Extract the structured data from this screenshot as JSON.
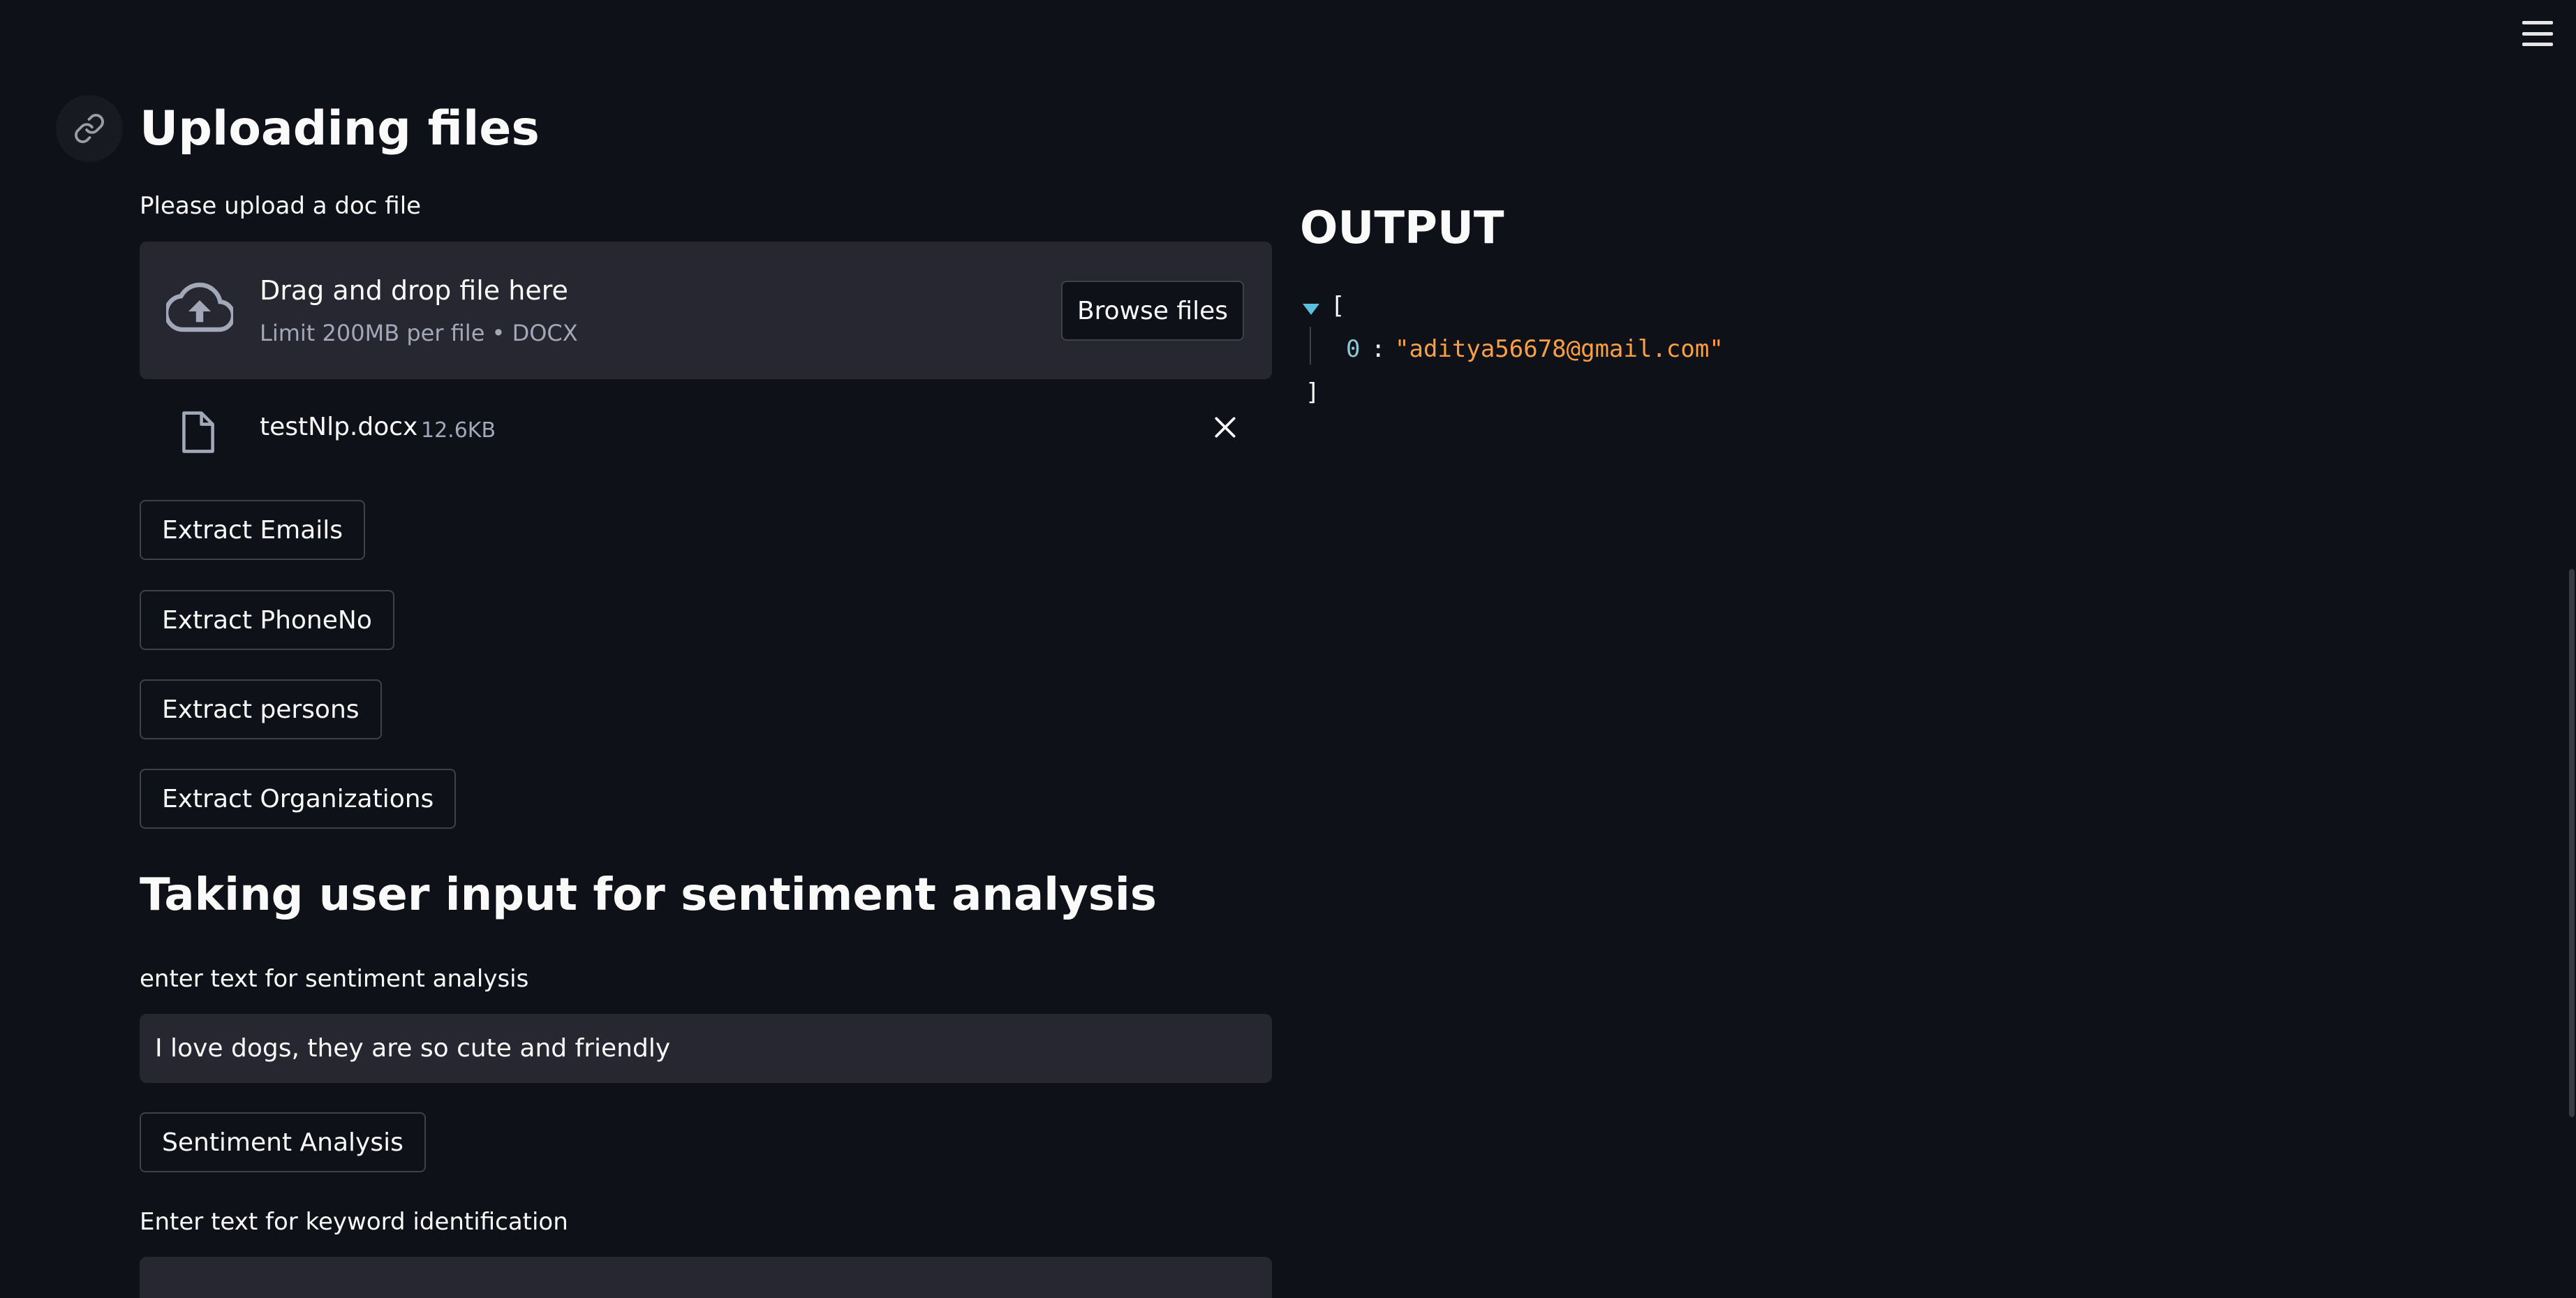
{
  "header": {
    "menu_icon": "hamburger-menu-icon"
  },
  "upload_section": {
    "title": "Uploading files",
    "anchor_icon": "link-icon",
    "uploader_label": "Please upload a doc file",
    "dropzone": {
      "icon": "cloud-upload-icon",
      "title": "Drag and drop file here",
      "subtitle": "Limit 200MB per file • DOCX",
      "browse_label": "Browse files"
    },
    "uploaded_file": {
      "icon": "file-icon",
      "name": "testNlp.docx",
      "size": "12.6KB",
      "remove_icon": "close-icon"
    },
    "buttons": {
      "emails": "Extract Emails",
      "phone": "Extract PhoneNo",
      "persons": "Extract persons",
      "organizations": "Extract Organizations"
    }
  },
  "sentiment_section": {
    "title": "Taking user input for sentiment analysis",
    "input_label": "enter text for sentiment analysis",
    "input_value": "I love dogs, they are so cute and friendly",
    "button": "Sentiment Analysis",
    "keyword_label": "Enter text for keyword identification",
    "keyword_value": ""
  },
  "output": {
    "title": "OUTPUT",
    "json": {
      "open_bracket": "[",
      "close_bracket": "]",
      "items": [
        {
          "key": "0",
          "value": "\"aditya56678@gmail.com\""
        }
      ]
    }
  },
  "colors": {
    "background": "#0e1117",
    "widget_bg": "#262730",
    "json_key": "#8bc7d4",
    "json_string": "#ff9f43"
  }
}
